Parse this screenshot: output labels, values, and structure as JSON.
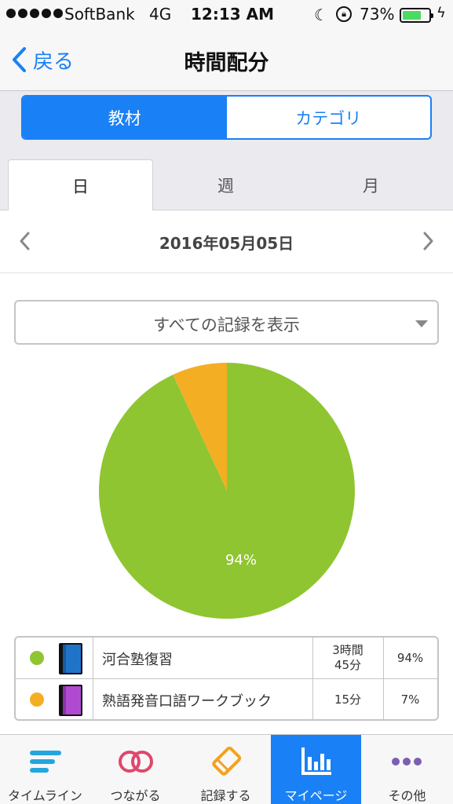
{
  "status_bar": {
    "carrier": "SoftBank",
    "network": "4G",
    "time": "12:13 AM",
    "battery_percent": "73%"
  },
  "nav": {
    "back_label": "戻る",
    "title": "時間配分"
  },
  "segment": {
    "items": [
      "教材",
      "カテゴリ"
    ],
    "selected": "教材"
  },
  "period_tabs": {
    "items": [
      "日",
      "週",
      "月"
    ],
    "selected": "日"
  },
  "date": "2016年05月05日",
  "filter": {
    "selected": "すべての記録を表示"
  },
  "chart_data": {
    "type": "pie",
    "slices": [
      {
        "label": "河合塾復習",
        "value": 94,
        "color": "#8fc531"
      },
      {
        "label": "熟語発音口語ワークブック",
        "value": 7,
        "color": "#f4ae24"
      }
    ],
    "data_labels": [
      "94%"
    ]
  },
  "legend": {
    "rows": [
      {
        "name": "河合塾復習",
        "time_line1": "3時間",
        "time_line2": "45分",
        "percent": "94%",
        "dot_color": "#8fc531",
        "book_color": "#1f74c8"
      },
      {
        "name": "熟語発音口語ワークブック",
        "time_line1": "15分",
        "time_line2": "",
        "percent": "7%",
        "dot_color": "#f4ae24",
        "book_color": "#b04ad1"
      }
    ]
  },
  "tab_bar": {
    "items": [
      {
        "label": "タイムライン",
        "icon": "timeline-icon"
      },
      {
        "label": "つながる",
        "icon": "rings-icon"
      },
      {
        "label": "記録する",
        "icon": "pencil-icon"
      },
      {
        "label": "マイページ",
        "icon": "bar-chart-icon"
      },
      {
        "label": "その他",
        "icon": "more-icon"
      }
    ],
    "selected": "マイページ"
  },
  "colors": {
    "accent": "#1a80f5",
    "green": "#8fc531",
    "orange": "#f4ae24"
  }
}
